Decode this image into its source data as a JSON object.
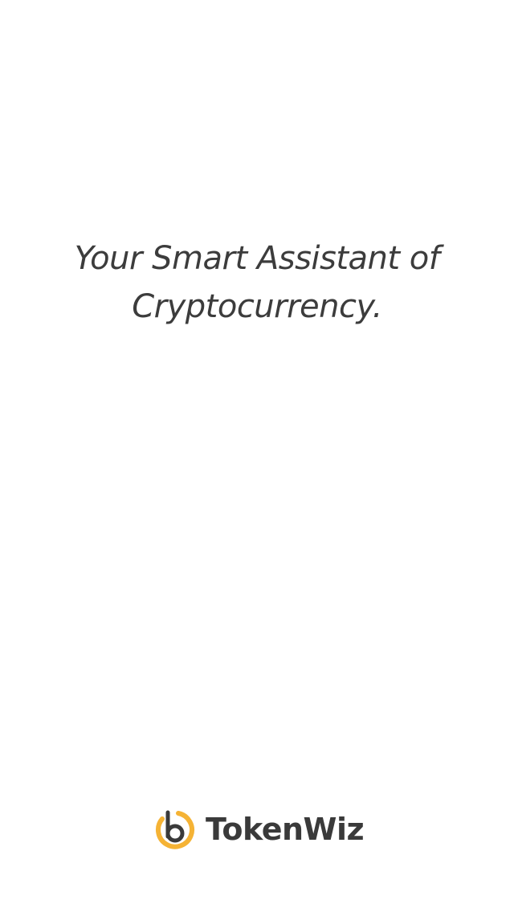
{
  "splash": {
    "tagline_line1": "Your Smart Assistant of",
    "tagline_line2": "Cryptocurrency."
  },
  "brand": {
    "name": "TokenWiz",
    "logo_icon": "tokenwiz-logo-icon",
    "colors": {
      "logo_ring": "#f5b335",
      "logo_letter": "#3a3a3a",
      "text": "#3c3c3c",
      "background": "#ffffff"
    }
  }
}
